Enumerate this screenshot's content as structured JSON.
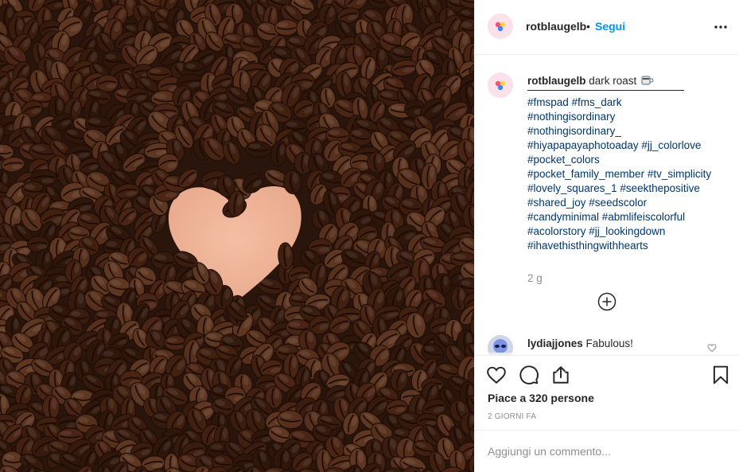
{
  "photo": {
    "alt_subject": "coffee-beans-heart"
  },
  "header": {
    "username": "rotblaugelb",
    "separator": "•",
    "follow_label": "Segui",
    "more_icon": "more-horizontal-icon"
  },
  "caption": {
    "username": "rotblaugelb",
    "text": "dark roast",
    "emoji_icon": "coffee-cup-icon",
    "hashtags": [
      "#fmspad #fms_dark",
      "#nothingisordinary",
      "#nothingisordinary_",
      "#hiyapapayaphotoaday #jj_colorlove",
      "#pocket_colors",
      "#pocket_family_member #tv_simplicity",
      "#lovely_squares_1 #seekthepositive",
      "#shared_joy #seedscolor",
      "#candyminimal #abmlifeiscolorful",
      "#acolorstory #jj_lookingdown",
      "#ihavethisthingwithhearts"
    ],
    "time": "2 g"
  },
  "comments": [
    {
      "username": "lydiajjones",
      "text": "Fabulous!"
    }
  ],
  "actions": {
    "likes_text": "Piace a 320 persone",
    "time_label": "2 GIORNI FA"
  },
  "add_comment": {
    "placeholder": "Aggiungi un commento..."
  },
  "colors": {
    "link": "#00376b",
    "follow": "#0095f6",
    "heart_shape": "#f2b69a",
    "beans": "#3b1d10"
  }
}
